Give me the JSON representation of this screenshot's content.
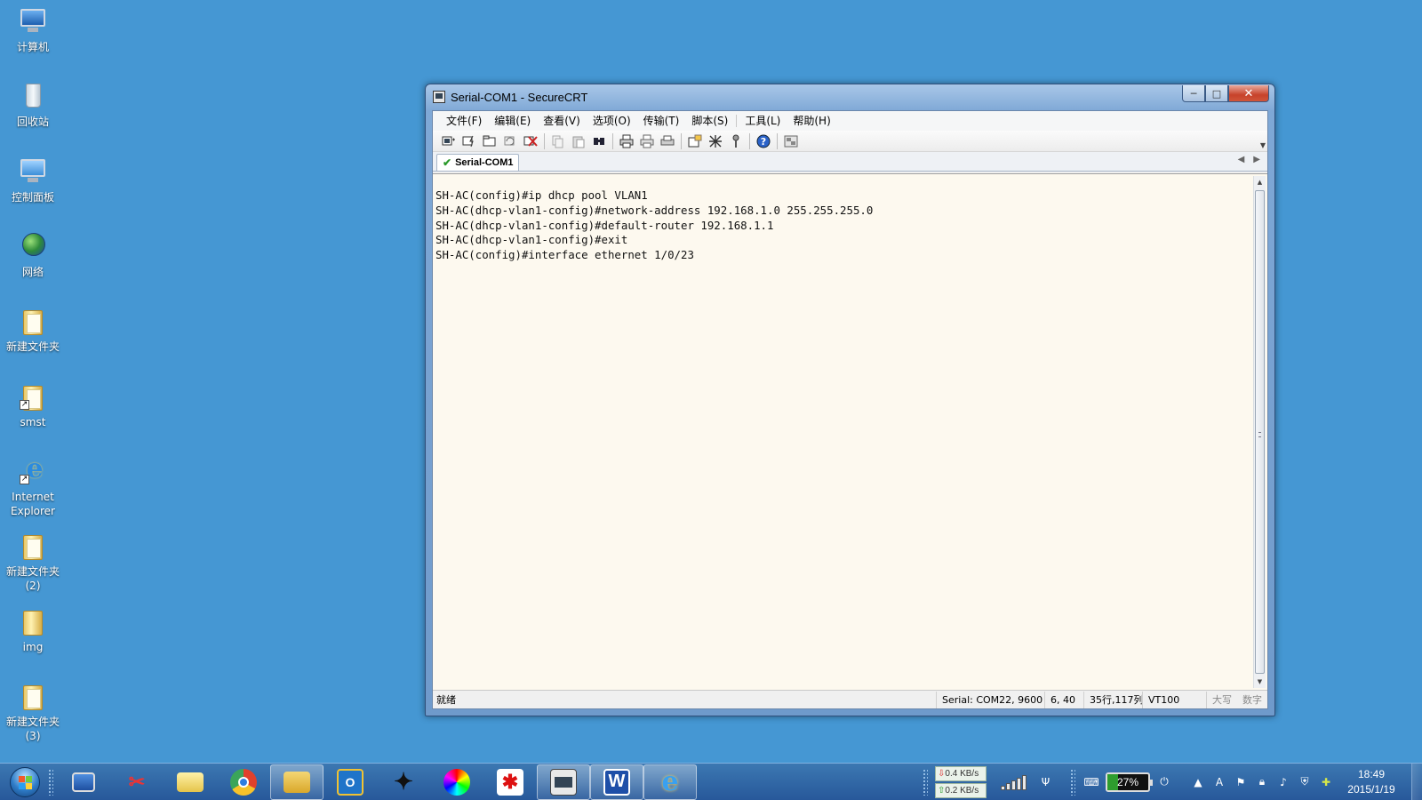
{
  "desktop": {
    "icons": [
      {
        "label": "计算机",
        "icon": "computer-icon"
      },
      {
        "label": "回收站",
        "icon": "recycle-bin-icon"
      },
      {
        "label": "控制面板",
        "icon": "control-panel-icon"
      },
      {
        "label": "网络",
        "icon": "network-icon"
      },
      {
        "label": "新建文件夹",
        "icon": "folder-icon"
      },
      {
        "label": "smst",
        "icon": "folder-shortcut-icon"
      },
      {
        "label": "Internet Explorer",
        "icon": "internet-explorer-icon"
      },
      {
        "label": "新建文件夹 (2)",
        "icon": "folder-icon"
      },
      {
        "label": "img",
        "icon": "folder-icon"
      },
      {
        "label": "新建文件夹 (3)",
        "icon": "folder-icon"
      }
    ],
    "background_color": "#4597d3"
  },
  "window": {
    "title": "Serial-COM1 - SecureCRT",
    "caption": {
      "minimize": "─",
      "maximize": "□",
      "close": "✕"
    },
    "menu": [
      "文件(F)",
      "编辑(E)",
      "查看(V)",
      "选项(O)",
      "传输(T)",
      "脚本(S)",
      "工具(L)",
      "帮助(H)"
    ],
    "toolbar_icons": [
      "connect-icon",
      "quick-connect-icon",
      "connect-in-tab-icon",
      "reconnect-icon",
      "disconnect-icon",
      "copy-icon",
      "paste-icon",
      "find-icon",
      "print-icon",
      "print-selection-icon",
      "print-setup-icon",
      "session-options-icon",
      "global-options-icon",
      "keymap-icon",
      "help-icon",
      "sftp-icon"
    ],
    "tab": {
      "label": "Serial-COM1",
      "status_icon": "connected-check-icon"
    },
    "terminal_lines": [
      "SH-AC(config)#ip dhcp pool VLAN1",
      "SH-AC(dhcp-vlan1-config)#network-address 192.168.1.0 255.255.255.0",
      "SH-AC(dhcp-vlan1-config)#default-router 192.168.1.1",
      "SH-AC(dhcp-vlan1-config)#exit",
      "SH-AC(config)#interface ethernet 1/0/23"
    ],
    "status": {
      "ready": "就绪",
      "serial": "Serial: COM22, 9600",
      "cursor": "6,  40",
      "size": "35行,117列",
      "emulation": "VT100",
      "caps": "大写",
      "num": "数字"
    },
    "terminal_background": "#fdf9ef"
  },
  "taskbar": {
    "apps": [
      {
        "name": "remote-desktop-icon",
        "active": false
      },
      {
        "name": "snipping-tool-icon",
        "active": false
      },
      {
        "name": "file-folder-icon",
        "active": false
      },
      {
        "name": "chrome-icon",
        "active": false
      },
      {
        "name": "windows-explorer-icon",
        "active": true
      },
      {
        "name": "outlook-icon",
        "active": false
      },
      {
        "name": "ti-calculator-icon",
        "active": false
      },
      {
        "name": "color-picker-icon",
        "active": false
      },
      {
        "name": "red-app-icon",
        "active": false
      },
      {
        "name": "securecrt-icon",
        "active": true
      },
      {
        "name": "word-icon",
        "active": true
      },
      {
        "name": "ie-icon",
        "active": true
      }
    ],
    "net_down": "0.4 KB/s",
    "net_up": "0.2 KB/s",
    "battery_percent": 27,
    "battery_label": "27%",
    "tray_icons": [
      "show-hidden-icon",
      "input-method-icon",
      "flag-icon",
      "lock-icon",
      "volume-icon",
      "security-shield-icon",
      "update-icon"
    ],
    "time": "18:49",
    "date": "2015/1/19"
  }
}
